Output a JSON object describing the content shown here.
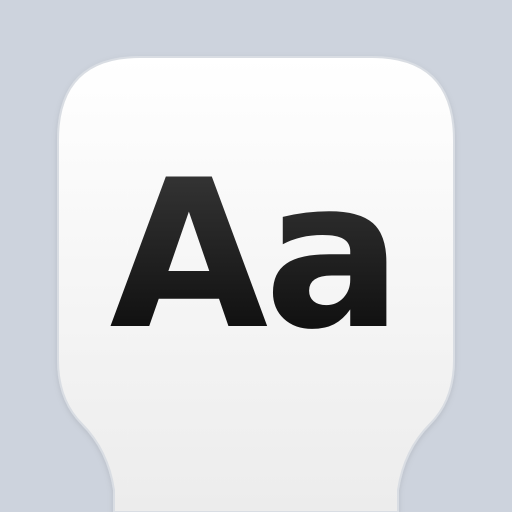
{
  "icon": {
    "name": "font-preview-icon",
    "glyph_text": "Aa"
  },
  "colors": {
    "background": "#cdd3dd",
    "card_top": "#ffffff",
    "card_bottom": "#efefef",
    "card_outline": "#d9dde3",
    "glyph_top": "#3a3a3a",
    "glyph_bottom": "#050505"
  }
}
